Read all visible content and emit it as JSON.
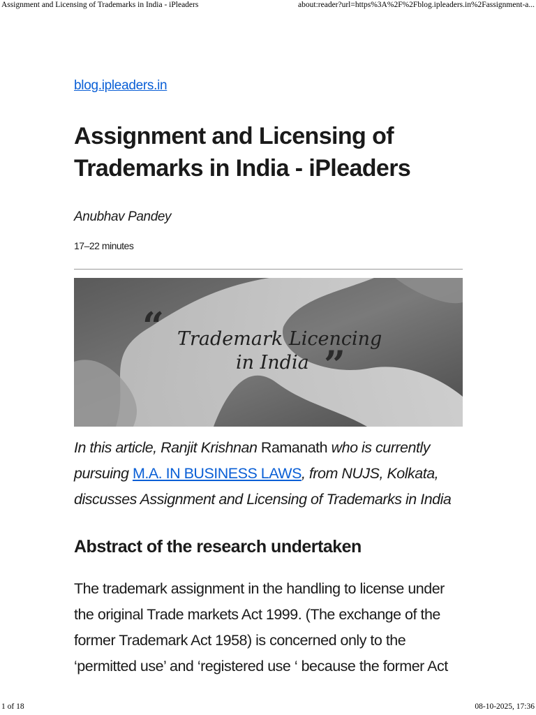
{
  "print_header": {
    "title": "Assignment and Licensing of Trademarks in India - iPleaders",
    "url": "about:reader?url=https%3A%2F%2Fblog.ipleaders.in%2Fassignment-a..."
  },
  "print_footer": {
    "page": "1 of 18",
    "datetime": "08-10-2025, 17:36"
  },
  "article": {
    "site": "blog.ipleaders.in",
    "title": "Assignment and Licensing of Trademarks in India - iPleaders",
    "author": "Anubhav Pandey",
    "read_time": "17–22 minutes",
    "hero": {
      "line1": "Trademark Licencing",
      "line2": "in India",
      "open_quote": "“",
      "close_quote": "”"
    },
    "intro": {
      "part1": "In this article, Ranjit Krishnan",
      "part2": " Ramanath ",
      "part3": "who is currently pursuing ",
      "link": "M.A. IN BUSINESS LAWS",
      "part4": ", from NUJS, Kolkata, discusses Assignment and Licensing of Trademarks in India"
    },
    "section_heading": "Abstract of the research undertaken",
    "paragraph": "The trademark assignment in the handling to license under the original Trade markets Act 1999. (The exchange of the former Trademark Act 1958) is concerned only to the ‘permitted use’ and ‘registered use ‘ because the former Act"
  }
}
